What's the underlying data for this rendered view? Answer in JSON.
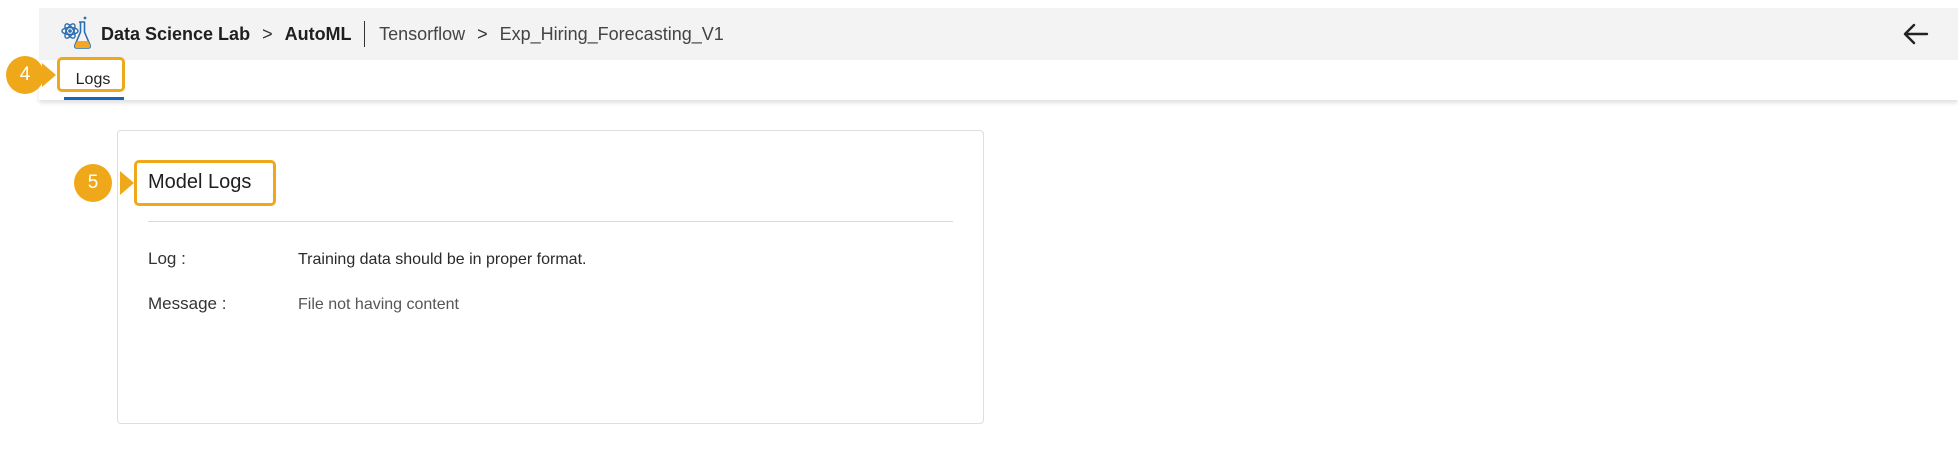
{
  "header": {
    "breadcrumbs": {
      "root": "Data Science Lab",
      "section": "AutoML",
      "framework": "Tensorflow",
      "experiment": "Exp_Hiring_Forecasting_V1"
    },
    "separator": ">",
    "app_icon": "science-flask-icon",
    "back_icon": "arrow-left-icon"
  },
  "tabs": {
    "active_label": "Logs"
  },
  "callouts": {
    "tab_marker": "4",
    "title_marker": "5"
  },
  "card": {
    "title": "Model Logs",
    "rows": [
      {
        "label": "Log :",
        "value": "Training data should be in proper format."
      },
      {
        "label": "Message :",
        "value": "File not having content"
      }
    ]
  },
  "colors": {
    "accent_blue": "#1565c0",
    "callout_orange": "#f0a81b",
    "header_bg": "#f3f3f3"
  }
}
